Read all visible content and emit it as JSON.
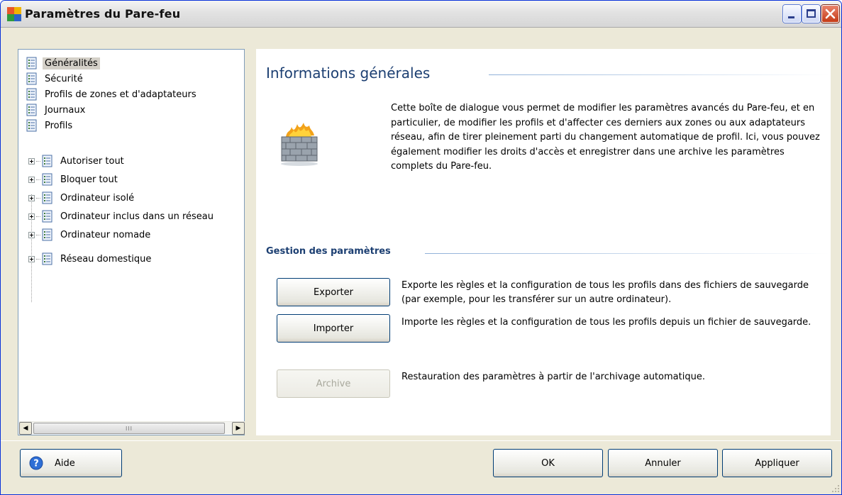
{
  "window": {
    "title": "Paramètres du Pare-feu"
  },
  "tree": {
    "items": [
      {
        "label": "Généralités",
        "selected": true
      },
      {
        "label": "Sécurité"
      },
      {
        "label": "Profils de zones et d'adaptateurs"
      },
      {
        "label": "Journaux"
      },
      {
        "label": "Profils"
      }
    ],
    "profiles": [
      {
        "label": "Autoriser tout"
      },
      {
        "label": "Bloquer tout"
      },
      {
        "label": "Ordinateur isolé"
      },
      {
        "label": "Ordinateur inclus dans un réseau"
      },
      {
        "label": "Ordinateur nomade"
      },
      {
        "label": "Réseau domestique"
      }
    ],
    "scroll_thumb_glyph": "III"
  },
  "content": {
    "heading": "Informations générales",
    "intro": "Cette boîte de dialogue vous permet de modifier les paramètres avancés du Pare-feu, et en particulier, de modifier les profils et d'affecter ces derniers aux zones ou aux adaptateurs réseau, afin de tirer pleinement parti du changement automatique de profil. Ici, vous pouvez également modifier les droits d'accès et enregistrer dans une archive les paramètres complets du Pare-feu.",
    "settings_heading": "Gestion des paramètres",
    "export": {
      "label": "Exporter",
      "description": "Exporte les règles et la configuration de tous les profils dans des fichiers de sauvegarde (par exemple, pour les transférer sur un autre ordinateur)."
    },
    "import": {
      "label": "Importer",
      "description": "Importe les règles et la configuration de tous les profils depuis un fichier de sauvegarde."
    },
    "archive": {
      "label": "Archive",
      "description": "Restauration des paramètres à partir de l'archivage automatique.",
      "disabled": true
    }
  },
  "footer": {
    "help_label": "Aide",
    "ok_label": "OK",
    "cancel_label": "Annuler",
    "apply_label": "Appliquer"
  }
}
